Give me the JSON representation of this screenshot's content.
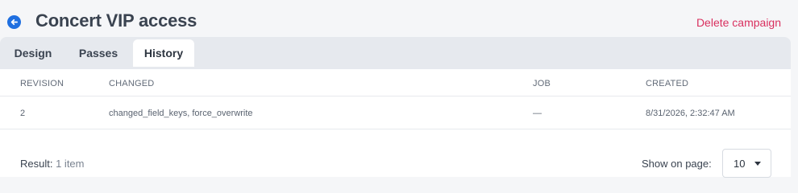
{
  "header": {
    "title": "Concert VIP access",
    "back_icon": "arrow-left-circle-icon",
    "delete_label": "Delete campaign",
    "accent": "#1f6fe0",
    "danger": "#d9305f"
  },
  "tabs": [
    {
      "label": "Design",
      "active": false
    },
    {
      "label": "Passes",
      "active": false
    },
    {
      "label": "History",
      "active": true
    }
  ],
  "table": {
    "columns": [
      "REVISION",
      "CHANGED",
      "JOB",
      "CREATED"
    ],
    "rows": [
      {
        "revision": "2",
        "changed": "changed_field_keys, force_overwrite",
        "job": "—",
        "created": "8/31/2026, 2:32:47 AM"
      }
    ]
  },
  "footer": {
    "result_label": "Result:",
    "result_count": "1 item",
    "show_label": "Show on page:",
    "page_size": "10"
  }
}
